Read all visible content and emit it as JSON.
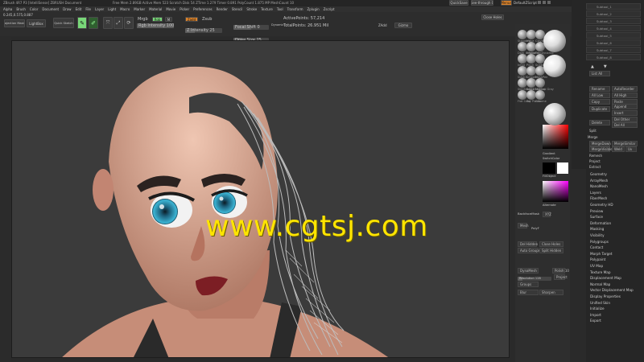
{
  "titlebar": {
    "app_info": "ZBrush 4R7 P3 [IntelliSense] ZBRUSH Document",
    "stats": "Free Mem 2.89GB  Active Mem 523  Scratch Disk 54  ZTime 1.279  Timer 0.891  PolyCount 1.875 MP  MeshCount 10",
    "quicksave": "QuickSave",
    "see_through": "See-through 0",
    "menus": "Menus",
    "default_zscript": "DefaultZScript"
  },
  "menubar": {
    "items": [
      "Alpha",
      "Brush",
      "Color",
      "Document",
      "Draw",
      "Edit",
      "File",
      "Layer",
      "Light",
      "Macro",
      "Marker",
      "Material",
      "Movie",
      "Picker",
      "Preferences",
      "Render",
      "Stencil",
      "Stroke",
      "Texture",
      "Tool",
      "Transform",
      "Zplugin",
      "Zscript"
    ]
  },
  "toolbar": {
    "coords": "0.245,0.575,0.887",
    "projection_master": "Projection Master",
    "lightbox": "LightBox",
    "quick_sketch": "Quick Sketch",
    "edit": "Edit",
    "draw": "Draw",
    "mrgb": "Mrgb",
    "rgb": "Rgb",
    "m": "M",
    "rgb_intensity": "Rgb Intensity 100",
    "zadd": "Zadd",
    "zsub": "Zsub",
    "z_intensity": "Z Intensity 25",
    "focal_shift": "Focal Shift 0",
    "draw_size": "Draw Size 25",
    "dynamic": "Dynamic",
    "active_points": "ActivePoints: 57,214",
    "total_points": "TotalPoints: 26.951 Mil",
    "zadd_button": "ZAdd",
    "gizmo": "Gizmo",
    "zremesher": "ZRemesher",
    "close_holes": "Close Holes"
  },
  "canvas": {
    "watermark": "www.cgtsj.com"
  },
  "right_tray": {
    "tiles": [
      {
        "label": "Standard"
      },
      {
        "label": "Move"
      },
      {
        "label": "ClayBuildup"
      },
      {
        "label": "Dam_Standard"
      },
      {
        "label": "hPolish"
      },
      {
        "label": "TrimDynamic"
      },
      {
        "label": "Inflat"
      },
      {
        "label": "Pinch"
      },
      {
        "label": "SnakeHook"
      },
      {
        "label": "Slash3"
      },
      {
        "label": "Smooth"
      },
      {
        "label": "MaskPen"
      },
      {
        "label": "SkinShade4"
      },
      {
        "label": "BasicMaterial"
      },
      {
        "label": "MatCap Gray"
      },
      {
        "label": "Flat Color"
      },
      {
        "label": "Toy Plastic"
      },
      {
        "label": "Chrome"
      }
    ],
    "gradient": "Gradient",
    "switch_color": "SwitchColor",
    "fill_object": "FillObject",
    "alternate": "Alternate",
    "backface_mask": "BackfaceMask",
    "polyframe": "PolyF",
    "transp": "Transp",
    "groups_split": "Group Split",
    "del_hidden": "Del Hidden",
    "close_holes": "Close Holes",
    "auto_groups": "Auto Groups",
    "split_hidden": "Split Hidden",
    "dynamesh": "DynaMesh",
    "polish": "Polish 10",
    "resolution": "Resolution 128",
    "project": "Project",
    "groups": "Groups",
    "blur": "Blur",
    "sharpen": "Sharpen",
    "mesh_icon": "Mesh",
    "xyz_label": "XYZ"
  },
  "subtool": {
    "items": [
      "Subtool_1",
      "Subtool_2",
      "Subtool_3",
      "Subtool_4",
      "Subtool_5",
      "Subtool_6",
      "Subtool_7",
      "Subtool_8"
    ],
    "list_all": "List All",
    "rename": "Rename",
    "auto_reorder": "AutoReorder",
    "all_low": "All Low",
    "all_high": "All High",
    "copy": "Copy",
    "paste": "Paste",
    "duplicate": "Duplicate",
    "append": "Append",
    "insert": "Insert",
    "delete": "Delete",
    "del_other": "Del Other",
    "del_all": "Del All",
    "split": "Split",
    "merge": "Merge",
    "merge_down": "MergeDown",
    "merge_similar": "MergeSimilar",
    "merge_visible": "MergeVisible",
    "weld": "Weld",
    "uv": "Uv",
    "remesh": "Remesh",
    "project": "Project",
    "extract": "Extract"
  },
  "tool_menu": {
    "items": [
      "Geometry",
      "ArrayMesh",
      "NanoMesh",
      "Layers",
      "FiberMesh",
      "Geometry HD",
      "Preview",
      "Surface",
      "Deformation",
      "Masking",
      "Visibility",
      "Polygroups",
      "Contact",
      "Morph Target",
      "Polypaint",
      "UV Map",
      "Texture Map",
      "Displacement Map",
      "Normal Map",
      "Vector Displacement Map",
      "Display Properties",
      "Unified Skin",
      "Initialize",
      "Import",
      "Export"
    ]
  }
}
